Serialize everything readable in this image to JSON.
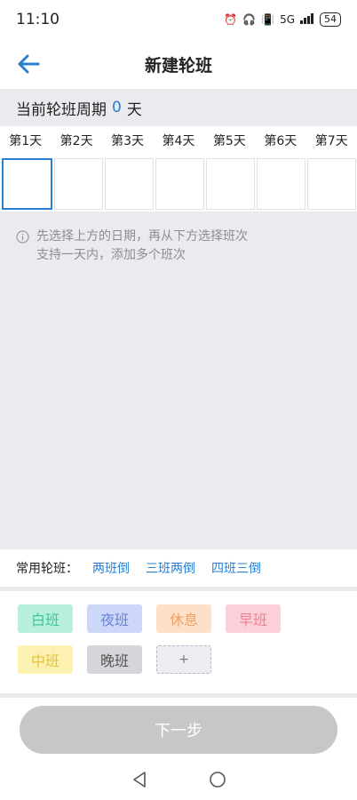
{
  "status_bar": {
    "time": "11:10",
    "network": "5G",
    "battery": "54"
  },
  "header": {
    "title": "新建轮班"
  },
  "cycle": {
    "label": "当前轮班周期",
    "value": "0",
    "unit": "天"
  },
  "days": [
    "第1天",
    "第2天",
    "第3天",
    "第4天",
    "第5天",
    "第6天",
    "第7天"
  ],
  "hint": {
    "line1": "先选择上方的日期，再从下方选择班次",
    "line2": "支持一天内，添加多个班次"
  },
  "common_shifts": {
    "label": "常用轮班：",
    "options": [
      "两班倒",
      "三班两倒",
      "四班三倒"
    ]
  },
  "shifts": [
    {
      "label": "白班",
      "bg": "#b8f0dd",
      "fg": "#3cc79a"
    },
    {
      "label": "夜班",
      "bg": "#cdd8f8",
      "fg": "#6a83d8"
    },
    {
      "label": "休息",
      "bg": "#fde0c8",
      "fg": "#f0a060"
    },
    {
      "label": "早班",
      "bg": "#fbd0d8",
      "fg": "#ee8097"
    },
    {
      "label": "中班",
      "bg": "#fdf1b2",
      "fg": "#e6c13c"
    },
    {
      "label": "晚班",
      "bg": "#d6d6da",
      "fg": "#555555"
    }
  ],
  "add_shift_label": "+",
  "next_button": "下一步",
  "colors": {
    "accent": "#2b7fd0",
    "background_grey": "#ebebef",
    "button_disabled": "#c7c7c7"
  }
}
